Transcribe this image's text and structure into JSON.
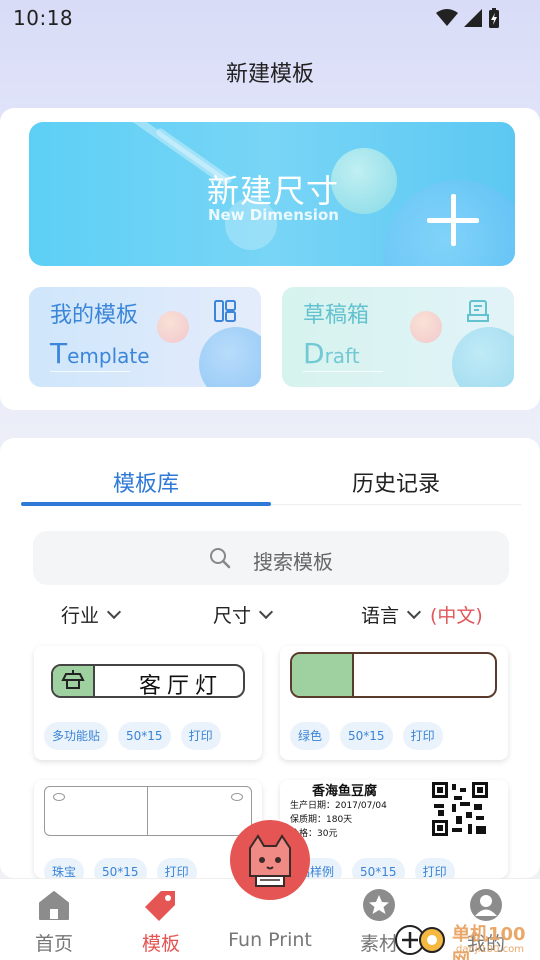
{
  "status": {
    "time": "10:18"
  },
  "header": {
    "title": "新建模板"
  },
  "new_dimension": {
    "title": "新建尺寸",
    "subtitle": "New Dimension"
  },
  "cards": {
    "my_templates": {
      "cn": "我的模板",
      "en_initial": "T",
      "en_rest": "emplate"
    },
    "drafts": {
      "cn": "草稿箱",
      "en_initial": "D",
      "en_rest": "raft"
    }
  },
  "tabs": [
    {
      "label": "模板库",
      "active": true
    },
    {
      "label": "历史记录",
      "active": false
    }
  ],
  "search": {
    "placeholder": "搜索模板"
  },
  "filters": [
    {
      "label": "行业"
    },
    {
      "label": "尺寸"
    },
    {
      "label": "语言"
    }
  ],
  "language_value": "(中文)",
  "templates": [
    {
      "content_text": "客厅灯",
      "tags": [
        "多功能贴",
        "50*15",
        "打印"
      ]
    },
    {
      "content_text": "",
      "tags": [
        "绿色",
        "50*15",
        "打印"
      ]
    },
    {
      "content_text": "",
      "tags": [
        "珠宝",
        "50*15",
        "打印"
      ]
    },
    {
      "content_text": "香海鱼豆腐",
      "lines": [
        "生产日期：2017/07/04",
        "保质期：180天",
        "价格：30元"
      ],
      "tags": [
        "品样例",
        "50*15",
        "打印"
      ]
    }
  ],
  "bottom_nav": [
    {
      "label": "首页",
      "icon": "home-icon",
      "active": false
    },
    {
      "label": "模板",
      "icon": "tag-icon",
      "active": true
    },
    {
      "label": "Fun Print",
      "icon": "cat-icon",
      "active": false
    },
    {
      "label": "素材",
      "icon": "star-icon",
      "active": false
    },
    {
      "label": "我的",
      "icon": "user-icon",
      "active": false
    }
  ],
  "watermark": {
    "text": "单机100网",
    "url": "danji100.com"
  },
  "colors": {
    "accent": "#2f7ad6",
    "brand_red": "#e45553",
    "tag_text": "#3b84d5",
    "label_green": "#9ed0a0"
  }
}
